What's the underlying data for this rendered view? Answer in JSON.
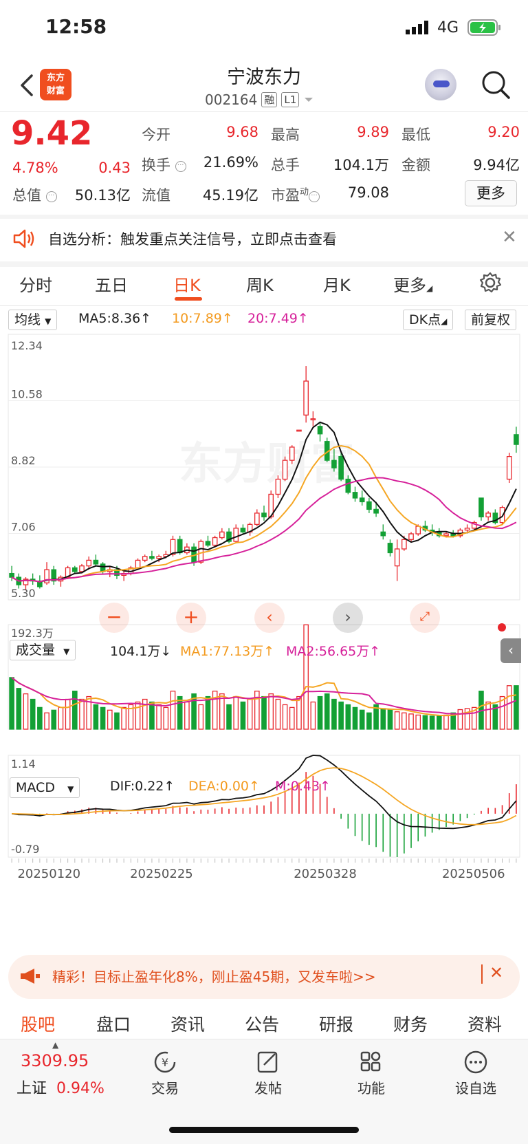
{
  "status_bar": {
    "time": "12:58",
    "network": "4G"
  },
  "header": {
    "logo_text": "东方财富",
    "stock_name": "宁波东力",
    "stock_code": "002164",
    "tag_margin": "融",
    "tag_level": "L1"
  },
  "quote": {
    "price": "9.42",
    "change_pct": "4.78%",
    "change": "0.43",
    "open_label": "今开",
    "open": "9.68",
    "high_label": "最高",
    "high": "9.89",
    "low_label": "最低",
    "low": "9.20",
    "turnover_label": "换手",
    "turnover": "21.69%",
    "volume_label": "总手",
    "volume": "104.1万",
    "amount_label": "金额",
    "amount": "9.94亿",
    "mktcap_label": "总值",
    "mktcap": "50.13亿",
    "float_label": "流值",
    "float_cap": "45.19亿",
    "pe_label": "市盈",
    "pe_sup": "动",
    "pe": "79.08",
    "more_button": "更多"
  },
  "alert": {
    "text": "自选分析：触发重点关注信号，立即点击查看"
  },
  "kline_tabs": [
    "分时",
    "五日",
    "日K",
    "周K",
    "月K",
    "更多"
  ],
  "kline_active": "日K",
  "main_indicator": {
    "select": "均线",
    "ma5": "MA5:8.36↑",
    "ma10": "10:7.89↑",
    "ma20": "20:7.49↑",
    "dk_button": "DK点",
    "adjust_button": "前复权"
  },
  "price_axis": [
    "12.34",
    "10.58",
    "8.82",
    "7.06",
    "5.30"
  ],
  "volume_indicator": {
    "select": "成交量",
    "vol": "104.1万↓",
    "ma1": "MA1:77.13万↑",
    "ma2": "MA2:56.65万↑",
    "max_label": "192.3万"
  },
  "macd_indicator": {
    "select": "MACD",
    "dif": "DIF:0.22↑",
    "dea": "DEA:0.00↑",
    "m": "M:0.43↑",
    "max_label": "1.14",
    "min_label": "-0.79"
  },
  "date_axis": [
    "20250120",
    "20250225",
    "20250328",
    "20250506"
  ],
  "colors": {
    "up": "#e8262c",
    "down": "#13a035",
    "ma5": "#111111",
    "ma10": "#f5a623",
    "ma20": "#d6219a",
    "accent": "#f04e1f"
  },
  "chart_data": {
    "type": "candlestick",
    "y_range": [
      5.3,
      12.34
    ],
    "candles": [
      [
        6.0,
        6.2,
        5.8,
        5.9
      ],
      [
        5.9,
        6.0,
        5.6,
        5.7
      ],
      [
        5.7,
        5.9,
        5.55,
        5.85
      ],
      [
        5.85,
        6.0,
        5.7,
        5.8
      ],
      [
        5.8,
        5.95,
        5.6,
        5.65
      ],
      [
        5.75,
        6.3,
        5.7,
        6.1
      ],
      [
        6.1,
        6.2,
        5.7,
        5.8
      ],
      [
        5.8,
        5.95,
        5.65,
        5.9
      ],
      [
        5.9,
        6.2,
        5.85,
        6.15
      ],
      [
        6.15,
        6.2,
        6.0,
        6.05
      ],
      [
        6.05,
        6.25,
        6.0,
        6.2
      ],
      [
        6.2,
        6.45,
        6.1,
        6.35
      ],
      [
        6.35,
        6.5,
        6.2,
        6.25
      ],
      [
        6.25,
        6.3,
        6.0,
        6.05
      ],
      [
        6.05,
        6.2,
        5.9,
        6.1
      ],
      [
        6.1,
        6.2,
        5.85,
        5.95
      ],
      [
        5.95,
        6.1,
        5.8,
        6.0
      ],
      [
        6.0,
        6.2,
        5.95,
        6.15
      ],
      [
        6.15,
        6.4,
        6.1,
        6.35
      ],
      [
        6.35,
        6.5,
        6.3,
        6.45
      ],
      [
        6.45,
        6.6,
        6.35,
        6.4
      ],
      [
        6.4,
        6.5,
        6.3,
        6.45
      ],
      [
        6.45,
        6.6,
        6.4,
        6.5
      ],
      [
        6.5,
        7.0,
        6.45,
        6.9
      ],
      [
        6.9,
        7.0,
        6.5,
        6.55
      ],
      [
        6.55,
        6.8,
        6.5,
        6.7
      ],
      [
        6.7,
        6.8,
        6.2,
        6.3
      ],
      [
        6.3,
        6.9,
        6.25,
        6.85
      ],
      [
        6.85,
        7.0,
        6.7,
        6.75
      ],
      [
        6.75,
        7.0,
        6.7,
        6.95
      ],
      [
        6.95,
        7.2,
        6.9,
        7.1
      ],
      [
        7.1,
        7.2,
        6.8,
        6.85
      ],
      [
        6.85,
        7.3,
        6.8,
        7.2
      ],
      [
        7.2,
        7.3,
        7.05,
        7.1
      ],
      [
        7.1,
        7.35,
        7.0,
        7.3
      ],
      [
        7.3,
        7.7,
        7.25,
        7.6
      ],
      [
        7.6,
        7.8,
        7.4,
        7.5
      ],
      [
        7.5,
        8.2,
        7.45,
        8.1
      ],
      [
        8.1,
        8.6,
        8.0,
        8.5
      ],
      [
        8.5,
        9.1,
        8.45,
        9.0
      ],
      [
        9.0,
        9.4,
        8.9,
        9.35
      ],
      [
        9.8,
        9.8,
        9.8,
        9.8
      ],
      [
        10.2,
        11.5,
        10.0,
        11.1
      ],
      [
        10.1,
        10.3,
        9.9,
        10.1
      ],
      [
        9.9,
        10.0,
        9.5,
        9.7
      ],
      [
        9.5,
        9.6,
        8.95,
        9.0
      ],
      [
        9.0,
        9.3,
        8.7,
        8.8
      ],
      [
        9.1,
        9.2,
        8.45,
        8.5
      ],
      [
        8.5,
        8.6,
        8.1,
        8.15
      ],
      [
        8.15,
        8.3,
        7.9,
        8.0
      ],
      [
        8.0,
        8.2,
        7.8,
        7.9
      ],
      [
        7.9,
        8.0,
        7.6,
        7.7
      ],
      [
        7.7,
        7.9,
        7.5,
        7.6
      ],
      [
        7.1,
        7.3,
        6.9,
        7.0
      ],
      [
        6.8,
        6.9,
        6.45,
        6.55
      ],
      [
        6.2,
        6.9,
        5.8,
        6.65
      ],
      [
        6.65,
        7.0,
        6.6,
        6.9
      ],
      [
        6.9,
        7.1,
        6.85,
        7.05
      ],
      [
        7.05,
        7.3,
        7.0,
        7.25
      ],
      [
        7.25,
        7.4,
        7.1,
        7.15
      ],
      [
        7.15,
        7.3,
        7.0,
        7.1
      ],
      [
        7.1,
        7.2,
        6.95,
        7.0
      ],
      [
        7.0,
        7.1,
        6.95,
        7.05
      ],
      [
        7.05,
        7.15,
        6.95,
        7.0
      ],
      [
        7.0,
        7.2,
        6.95,
        7.15
      ],
      [
        7.15,
        7.3,
        7.1,
        7.2
      ],
      [
        7.2,
        7.4,
        7.15,
        7.35
      ],
      [
        8.0,
        8.0,
        7.4,
        7.5
      ],
      [
        7.5,
        7.65,
        7.4,
        7.6
      ],
      [
        7.6,
        7.7,
        7.3,
        7.35
      ],
      [
        7.35,
        7.8,
        7.3,
        7.75
      ],
      [
        8.5,
        9.2,
        8.4,
        9.1
      ],
      [
        9.68,
        9.89,
        9.2,
        9.42
      ]
    ],
    "volume_max": 192.3,
    "volumes": [
      95,
      75,
      65,
      55,
      40,
      30,
      35,
      40,
      55,
      70,
      55,
      60,
      45,
      40,
      35,
      30,
      40,
      45,
      50,
      55,
      50,
      45,
      40,
      70,
      60,
      50,
      65,
      45,
      60,
      70,
      65,
      45,
      60,
      50,
      55,
      70,
      60,
      65,
      55,
      45,
      40,
      60,
      192,
      50,
      60,
      65,
      55,
      50,
      45,
      40,
      35,
      30,
      45,
      38,
      36,
      32,
      30,
      28,
      26,
      25,
      24,
      24,
      26,
      30,
      36,
      38,
      40,
      70,
      50,
      45,
      60,
      80,
      80
    ],
    "macd_range": [
      -0.79,
      1.14
    ]
  },
  "promo": {
    "text": "精彩！目标止盈年化8%，刚止盈45期，又发车啦>>"
  },
  "bottom_tabs": [
    "股吧",
    "盘口",
    "资讯",
    "公告",
    "研报",
    "财务",
    "资料"
  ],
  "bottom_tab_active": "股吧",
  "bottom_nav": {
    "index_value": "3309.95",
    "index_name": "上证",
    "index_pct": "0.94%",
    "trade": "交易",
    "post": "发帖",
    "func": "功能",
    "add_watch": "设自选"
  }
}
